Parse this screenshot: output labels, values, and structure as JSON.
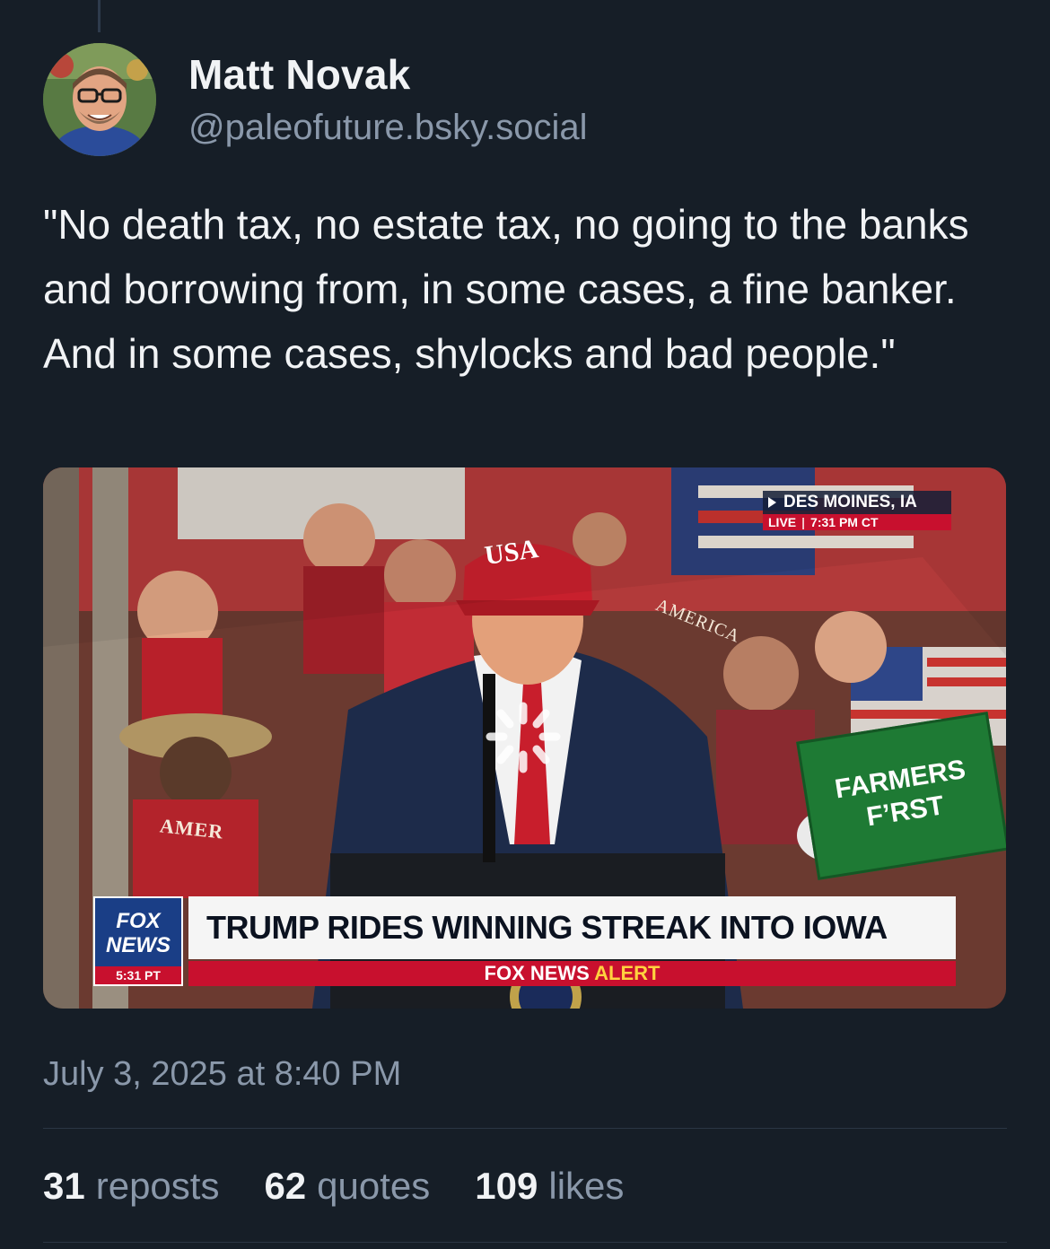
{
  "post": {
    "author": {
      "display_name": "Matt Novak",
      "handle": "@paleofuture.bsky.social"
    },
    "text": "\"No death tax, no estate tax, no going to the banks and borrowing from, in some cases, a fine banker. And in some cases, shylocks and bad people.\"",
    "timestamp": "July 3, 2025 at 8:40 PM",
    "stats": {
      "reposts": {
        "count": "31",
        "label": "reposts"
      },
      "quotes": {
        "count": "62",
        "label": "quotes"
      },
      "likes": {
        "count": "109",
        "label": "likes"
      }
    }
  },
  "media": {
    "location": "DES MOINES, IA",
    "live_label": "LIVE",
    "live_time": "7:31 PM CT",
    "hat_text": "USA",
    "banner_text": "AMERICA",
    "shirt_text": "AMER",
    "sign_line1": "FARMERS",
    "sign_line2": "F’RST",
    "network_line1": "FOX",
    "network_line2": "NEWS",
    "network_time": "5:31 PT",
    "headline": "TRUMP RIDES WINNING STREAK INTO IOWA",
    "alert_prefix": "FOX NEWS",
    "alert_word": "ALERT"
  },
  "colors": {
    "background": "#161e27",
    "text_primary": "#f1f3f5",
    "text_secondary": "#8a98aa",
    "fox_red": "#c8102e",
    "fox_blue": "#1a3e86"
  },
  "icons": {
    "loading": "loading-spinner-icon",
    "location_arrow": "play-triangle-icon"
  }
}
